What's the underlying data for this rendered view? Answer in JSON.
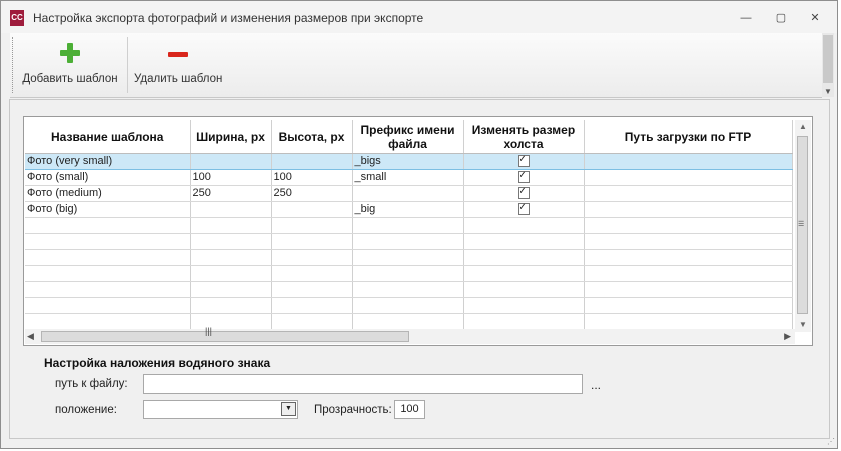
{
  "window": {
    "title": "Настройка экспорта фотографий и изменения размеров при экспорте",
    "icon_text": "CC",
    "minimize": "—",
    "restore": "▢",
    "close": "✕"
  },
  "toolbar": {
    "add_label": "Добавить шаблон",
    "remove_label": "Удалить шаблон"
  },
  "grid": {
    "columns": [
      "Название шаблона",
      "Ширина, px",
      "Высота, px",
      "Префикс имени файла",
      "Изменять размер холста",
      "Путь загрузки по FTP"
    ],
    "rows": [
      {
        "name": "Фото (very small)",
        "width": "",
        "height": "",
        "prefix": "_bigs",
        "resize": true,
        "ftp": ""
      },
      {
        "name": "Фото (small)",
        "width": "100",
        "height": "100",
        "prefix": "_small",
        "resize": true,
        "ftp": ""
      },
      {
        "name": "Фото (medium)",
        "width": "250",
        "height": "250",
        "prefix": "",
        "resize": true,
        "ftp": ""
      },
      {
        "name": "Фото (big)",
        "width": "",
        "height": "",
        "prefix": "_big",
        "resize": true,
        "ftp": ""
      }
    ],
    "empty_rows": 7,
    "selected_row": 0
  },
  "watermark": {
    "title": "Настройка наложения водяного знака",
    "path_label": "путь к файлу:",
    "path_value": "",
    "browse": "...",
    "position_label": "положение:",
    "position_value": "",
    "opacity_label": "Прозрачность:",
    "opacity_value": "100"
  },
  "colors": {
    "selected_row": "#cde8f7",
    "add_icon": "#4caf36",
    "remove_icon": "#d9261c",
    "app_icon": "#9e1c3c"
  }
}
